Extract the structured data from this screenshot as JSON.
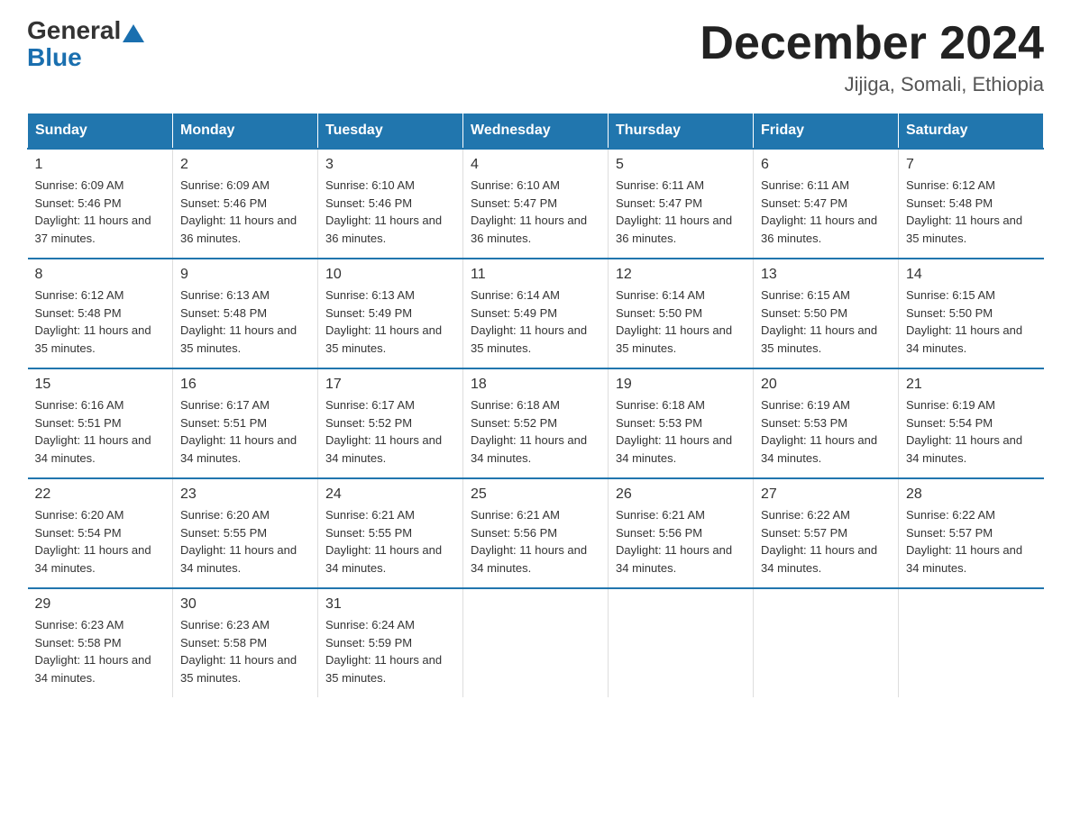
{
  "header": {
    "logo_general": "General",
    "logo_blue": "Blue",
    "month_title": "December 2024",
    "location": "Jijiga, Somali, Ethiopia"
  },
  "days_of_week": [
    "Sunday",
    "Monday",
    "Tuesday",
    "Wednesday",
    "Thursday",
    "Friday",
    "Saturday"
  ],
  "weeks": [
    [
      {
        "day": "1",
        "sunrise": "6:09 AM",
        "sunset": "5:46 PM",
        "daylight": "11 hours and 37 minutes."
      },
      {
        "day": "2",
        "sunrise": "6:09 AM",
        "sunset": "5:46 PM",
        "daylight": "11 hours and 36 minutes."
      },
      {
        "day": "3",
        "sunrise": "6:10 AM",
        "sunset": "5:46 PM",
        "daylight": "11 hours and 36 minutes."
      },
      {
        "day": "4",
        "sunrise": "6:10 AM",
        "sunset": "5:47 PM",
        "daylight": "11 hours and 36 minutes."
      },
      {
        "day": "5",
        "sunrise": "6:11 AM",
        "sunset": "5:47 PM",
        "daylight": "11 hours and 36 minutes."
      },
      {
        "day": "6",
        "sunrise": "6:11 AM",
        "sunset": "5:47 PM",
        "daylight": "11 hours and 36 minutes."
      },
      {
        "day": "7",
        "sunrise": "6:12 AM",
        "sunset": "5:48 PM",
        "daylight": "11 hours and 35 minutes."
      }
    ],
    [
      {
        "day": "8",
        "sunrise": "6:12 AM",
        "sunset": "5:48 PM",
        "daylight": "11 hours and 35 minutes."
      },
      {
        "day": "9",
        "sunrise": "6:13 AM",
        "sunset": "5:48 PM",
        "daylight": "11 hours and 35 minutes."
      },
      {
        "day": "10",
        "sunrise": "6:13 AM",
        "sunset": "5:49 PM",
        "daylight": "11 hours and 35 minutes."
      },
      {
        "day": "11",
        "sunrise": "6:14 AM",
        "sunset": "5:49 PM",
        "daylight": "11 hours and 35 minutes."
      },
      {
        "day": "12",
        "sunrise": "6:14 AM",
        "sunset": "5:50 PM",
        "daylight": "11 hours and 35 minutes."
      },
      {
        "day": "13",
        "sunrise": "6:15 AM",
        "sunset": "5:50 PM",
        "daylight": "11 hours and 35 minutes."
      },
      {
        "day": "14",
        "sunrise": "6:15 AM",
        "sunset": "5:50 PM",
        "daylight": "11 hours and 34 minutes."
      }
    ],
    [
      {
        "day": "15",
        "sunrise": "6:16 AM",
        "sunset": "5:51 PM",
        "daylight": "11 hours and 34 minutes."
      },
      {
        "day": "16",
        "sunrise": "6:17 AM",
        "sunset": "5:51 PM",
        "daylight": "11 hours and 34 minutes."
      },
      {
        "day": "17",
        "sunrise": "6:17 AM",
        "sunset": "5:52 PM",
        "daylight": "11 hours and 34 minutes."
      },
      {
        "day": "18",
        "sunrise": "6:18 AM",
        "sunset": "5:52 PM",
        "daylight": "11 hours and 34 minutes."
      },
      {
        "day": "19",
        "sunrise": "6:18 AM",
        "sunset": "5:53 PM",
        "daylight": "11 hours and 34 minutes."
      },
      {
        "day": "20",
        "sunrise": "6:19 AM",
        "sunset": "5:53 PM",
        "daylight": "11 hours and 34 minutes."
      },
      {
        "day": "21",
        "sunrise": "6:19 AM",
        "sunset": "5:54 PM",
        "daylight": "11 hours and 34 minutes."
      }
    ],
    [
      {
        "day": "22",
        "sunrise": "6:20 AM",
        "sunset": "5:54 PM",
        "daylight": "11 hours and 34 minutes."
      },
      {
        "day": "23",
        "sunrise": "6:20 AM",
        "sunset": "5:55 PM",
        "daylight": "11 hours and 34 minutes."
      },
      {
        "day": "24",
        "sunrise": "6:21 AM",
        "sunset": "5:55 PM",
        "daylight": "11 hours and 34 minutes."
      },
      {
        "day": "25",
        "sunrise": "6:21 AM",
        "sunset": "5:56 PM",
        "daylight": "11 hours and 34 minutes."
      },
      {
        "day": "26",
        "sunrise": "6:21 AM",
        "sunset": "5:56 PM",
        "daylight": "11 hours and 34 minutes."
      },
      {
        "day": "27",
        "sunrise": "6:22 AM",
        "sunset": "5:57 PM",
        "daylight": "11 hours and 34 minutes."
      },
      {
        "day": "28",
        "sunrise": "6:22 AM",
        "sunset": "5:57 PM",
        "daylight": "11 hours and 34 minutes."
      }
    ],
    [
      {
        "day": "29",
        "sunrise": "6:23 AM",
        "sunset": "5:58 PM",
        "daylight": "11 hours and 34 minutes."
      },
      {
        "day": "30",
        "sunrise": "6:23 AM",
        "sunset": "5:58 PM",
        "daylight": "11 hours and 35 minutes."
      },
      {
        "day": "31",
        "sunrise": "6:24 AM",
        "sunset": "5:59 PM",
        "daylight": "11 hours and 35 minutes."
      },
      null,
      null,
      null,
      null
    ]
  ]
}
